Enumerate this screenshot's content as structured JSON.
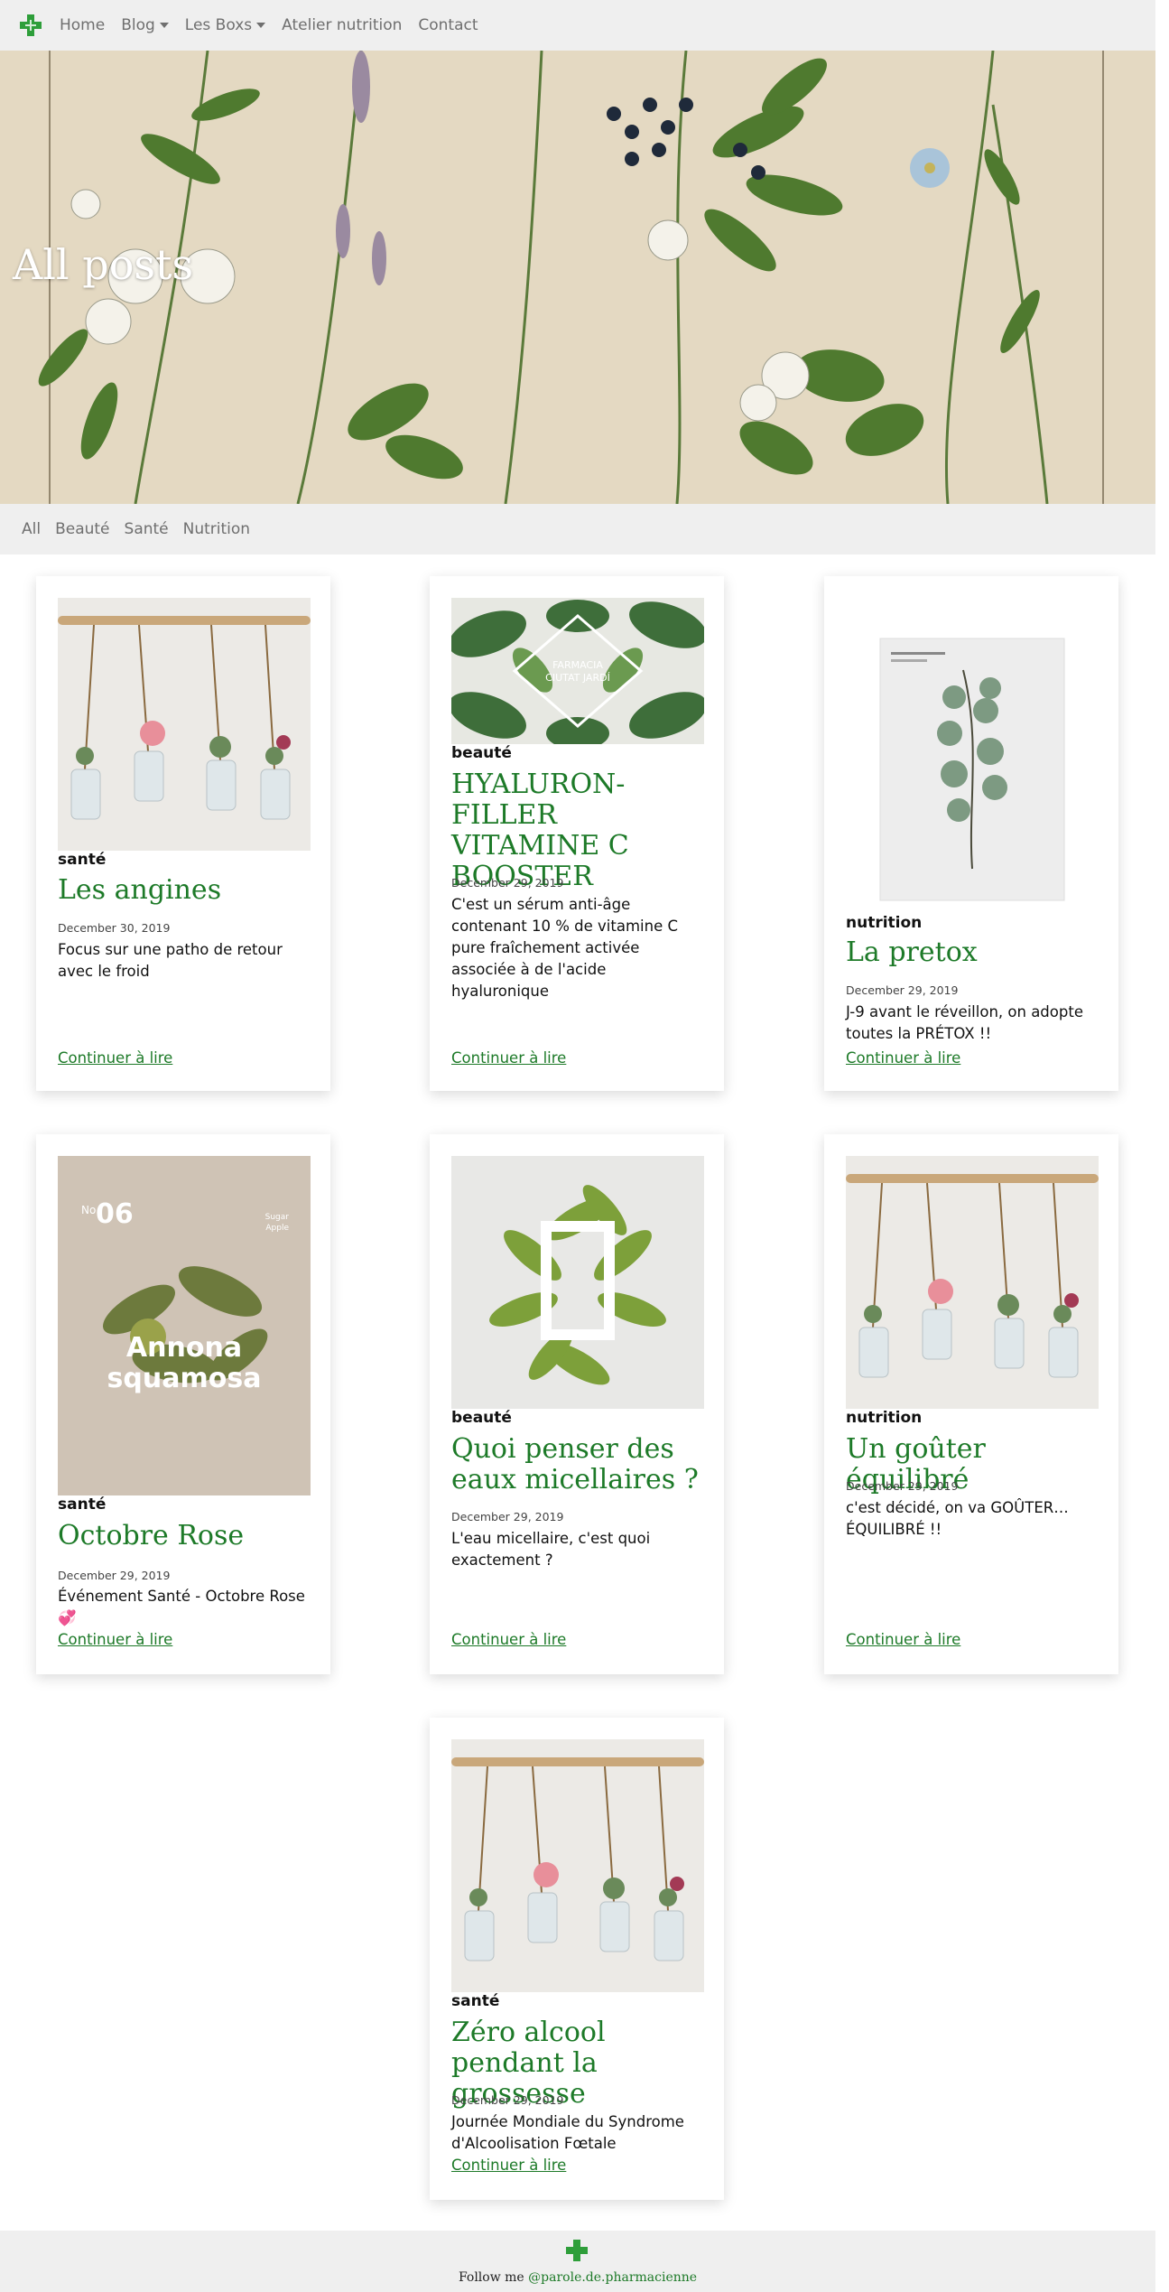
{
  "nav": {
    "logo_icon": "green-pharmacy-cross-icon",
    "items": [
      {
        "label": "Home",
        "dropdown": false
      },
      {
        "label": "Blog",
        "dropdown": true
      },
      {
        "label": "Les Boxs",
        "dropdown": true
      },
      {
        "label": "Atelier nutrition",
        "dropdown": false
      },
      {
        "label": "Contact",
        "dropdown": false
      }
    ]
  },
  "hero": {
    "title": "All posts"
  },
  "filters": [
    "All",
    "Beauté",
    "Santé",
    "Nutrition"
  ],
  "posts": [
    {
      "category": "santé",
      "title": "Les angines",
      "date": "December 30, 2019",
      "excerpt": "Focus sur une patho de retour avec le froid",
      "link": "Continuer à lire",
      "image": "hanging-jars-flowers"
    },
    {
      "category": "beauté",
      "title": "HYALURON-FILLER VITAMINE C BOOSTER",
      "date": "December 29, 2019",
      "excerpt": "C'est un sérum anti-âge contenant 10 % de vitamine C pure fraîchement activée associée à de l'acide hyaluronique",
      "link": "Continuer à lire",
      "image": "ciutat-jardi-leaves",
      "image_text": [
        "FARMACIA",
        "CIUTAT JARDÍ"
      ]
    },
    {
      "category": "nutrition",
      "title": "La pretox",
      "date": "December 29, 2019",
      "excerpt": "J-9 avant le réveillon, on adopte toutes la PRÉTOX !!",
      "link": "Continuer à lire",
      "image": "eucalyptus-poster"
    },
    {
      "category": "santé",
      "title": "Octobre Rose",
      "date": "December 29, 2019",
      "excerpt": "Événement Santé - Octobre Rose 💞",
      "link": "Continuer à lire",
      "image": "annona-squamosa-poster",
      "image_text": [
        "No",
        "06",
        "Annona",
        "squamosa",
        "Sugar",
        "Apple"
      ]
    },
    {
      "category": "beauté",
      "title": "Quoi penser des eaux micellaires ?",
      "date": "December 29, 2019",
      "excerpt": "L'eau micellaire, c'est quoi exactement ?",
      "link": "Continuer à lire",
      "image": "leaves-frame"
    },
    {
      "category": "nutrition",
      "title": "Un goûter équilibré",
      "date": "December 29, 2019",
      "excerpt": "c'est décidé, on va GOÛTER… ÉQUILIBRÉ !!",
      "link": "Continuer à lire",
      "image": "hanging-jars-flowers"
    },
    {
      "category": "santé",
      "title": "Zéro alcool pendant la grossesse",
      "date": "December 29, 2019",
      "excerpt": "Journée Mondiale du Syndrome d'Alcoolisation Fœtale",
      "link": "Continuer à lire",
      "image": "hanging-jars-flowers"
    }
  ],
  "footer": {
    "logo_icon": "green-pharmacy-cross-icon",
    "text": "Follow me",
    "handle": "@parole.de.pharmacienne"
  },
  "colors": {
    "accent": "#1d7a28",
    "bar_bg": "#efefef",
    "nav_text": "#6f6f6f"
  }
}
